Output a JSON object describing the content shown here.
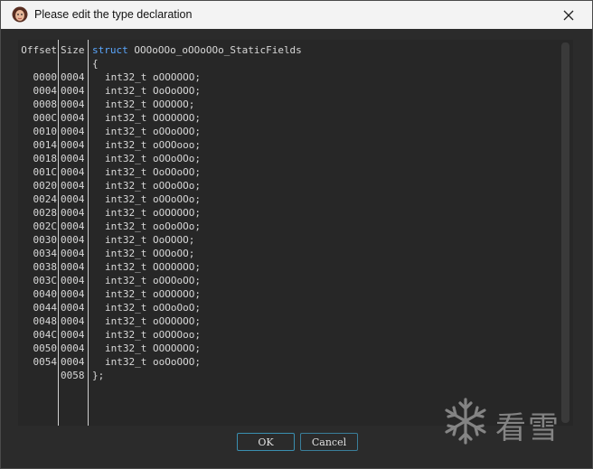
{
  "window": {
    "title": "Please edit the type declaration",
    "icons": {
      "app": "avatar-app-icon",
      "close": "close-icon"
    }
  },
  "editor": {
    "headers": {
      "offset": "Offset",
      "size": "Size"
    },
    "struct_keyword": "struct",
    "struct_name": "OOOoOOo_oOOoOOo_StaticFields",
    "open_brace": "{",
    "close_brace": "};",
    "end_size": "0058",
    "fields": [
      {
        "offset": "0000",
        "size": "0004",
        "decl": "int32_t oOOOOOO;"
      },
      {
        "offset": "0004",
        "size": "0004",
        "decl": "int32_t OoOoOOO;"
      },
      {
        "offset": "0008",
        "size": "0004",
        "decl": "int32_t OOOOOO;"
      },
      {
        "offset": "000C",
        "size": "0004",
        "decl": "int32_t OOOOOOO;"
      },
      {
        "offset": "0010",
        "size": "0004",
        "decl": "int32_t oOOoOOO;"
      },
      {
        "offset": "0014",
        "size": "0004",
        "decl": "int32_t oOOOooo;"
      },
      {
        "offset": "0018",
        "size": "0004",
        "decl": "int32_t oOOoOOo;"
      },
      {
        "offset": "001C",
        "size": "0004",
        "decl": "int32_t OoOOoOO;"
      },
      {
        "offset": "0020",
        "size": "0004",
        "decl": "int32_t oOOoOOo;"
      },
      {
        "offset": "0024",
        "size": "0004",
        "decl": "int32_t oOOoOOo;"
      },
      {
        "offset": "0028",
        "size": "0004",
        "decl": "int32_t oOOOOOO;"
      },
      {
        "offset": "002C",
        "size": "0004",
        "decl": "int32_t ooOoOOo;"
      },
      {
        "offset": "0030",
        "size": "0004",
        "decl": "int32_t OoOOOO;"
      },
      {
        "offset": "0034",
        "size": "0004",
        "decl": "int32_t OOOoOO;"
      },
      {
        "offset": "0038",
        "size": "0004",
        "decl": "int32_t OOOOOOO;"
      },
      {
        "offset": "003C",
        "size": "0004",
        "decl": "int32_t oOOOoOO;"
      },
      {
        "offset": "0040",
        "size": "0004",
        "decl": "int32_t oOOOOOO;"
      },
      {
        "offset": "0044",
        "size": "0004",
        "decl": "int32_t oOOoOoO;"
      },
      {
        "offset": "0048",
        "size": "0004",
        "decl": "int32_t oOOOOOO;"
      },
      {
        "offset": "004C",
        "size": "0004",
        "decl": "int32_t oOOOOoo;"
      },
      {
        "offset": "0050",
        "size": "0004",
        "decl": "int32_t OOOOOOO;"
      },
      {
        "offset": "0054",
        "size": "0004",
        "decl": "int32_t ooOoOOO;"
      }
    ]
  },
  "buttons": {
    "ok": "OK",
    "cancel": "Cancel"
  },
  "watermark": {
    "text": "看雪",
    "icon": "snowflake-icon"
  },
  "colors": {
    "keyword": "#5ba8ff",
    "button_border": "#3a8fb0"
  }
}
